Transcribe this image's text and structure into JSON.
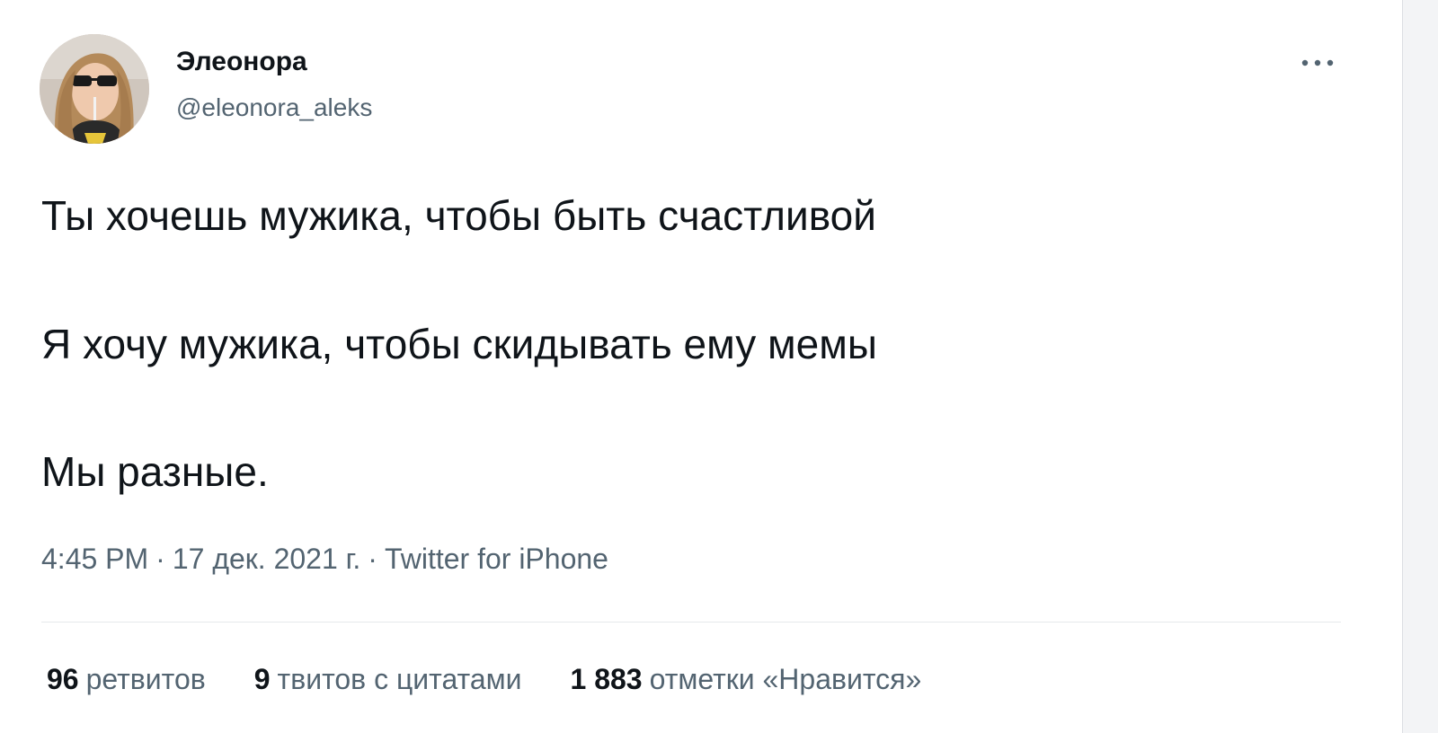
{
  "author": {
    "display_name": "Элеонора",
    "handle": "@eleonora_aleks"
  },
  "icons": {
    "more": "more-horizontal-icon",
    "avatar": "profile-photo"
  },
  "tweet": {
    "lines": [
      "Ты хочешь мужика, чтобы быть счастливой",
      "Я хочу мужика, чтобы скидывать ему мемы",
      "Мы разные."
    ],
    "time": "4:45 PM",
    "separator": "·",
    "date": "17 дек. 2021 г.",
    "source": "Twitter for iPhone"
  },
  "stats": {
    "retweets": {
      "count": "96",
      "label": "ретвитов"
    },
    "quotes": {
      "count": "9",
      "label": "твитов с цитатами"
    },
    "likes": {
      "count": "1 883",
      "label": "отметки «Нравится»"
    }
  },
  "colors": {
    "text_primary": "#0f1419",
    "text_secondary": "#536471",
    "divider": "#e6e9eb"
  }
}
